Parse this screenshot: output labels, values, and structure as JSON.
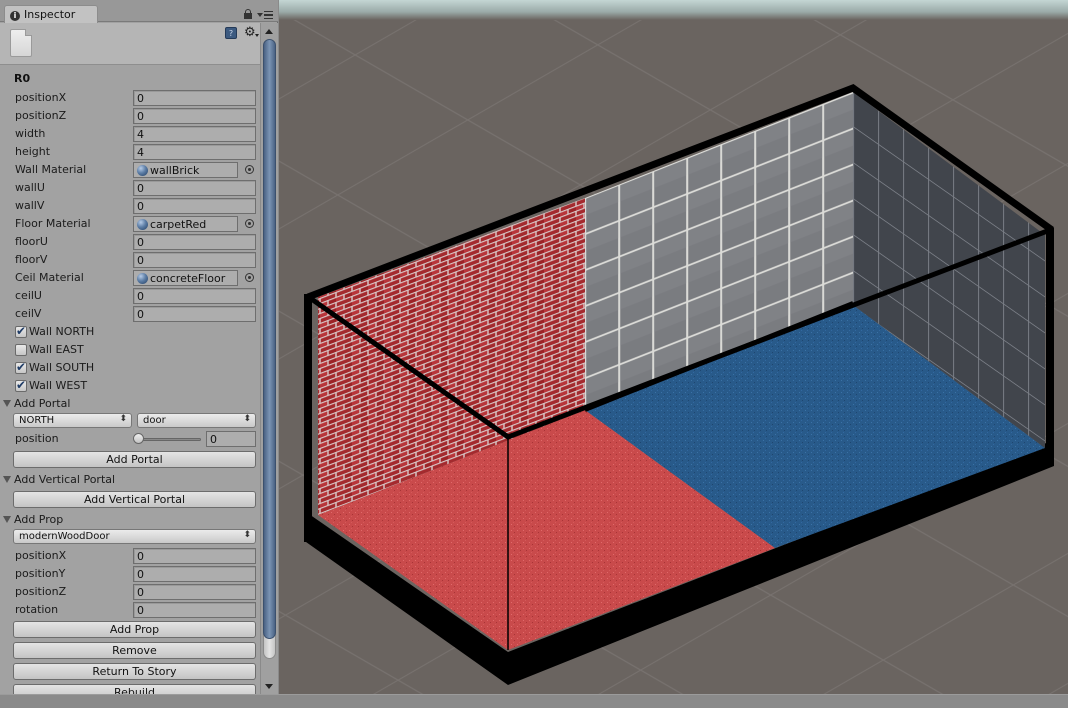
{
  "window": {
    "tab_title": "Inspector",
    "tab_icon": "i"
  },
  "header": {
    "help_glyph": "?",
    "gear_glyph": "⚙"
  },
  "object": {
    "name": "R0"
  },
  "fields": [
    {
      "label": "positionX",
      "value": "0"
    },
    {
      "label": "positionZ",
      "value": "0"
    },
    {
      "label": "width",
      "value": "4"
    },
    {
      "label": "height",
      "value": "4"
    },
    {
      "label": "Wall Material",
      "value": "wallBrick",
      "type": "material"
    },
    {
      "label": "wallU",
      "value": "0"
    },
    {
      "label": "wallV",
      "value": "0"
    },
    {
      "label": "Floor Material",
      "value": "carpetRed",
      "type": "material"
    },
    {
      "label": "floorU",
      "value": "0"
    },
    {
      "label": "floorV",
      "value": "0"
    },
    {
      "label": "Ceil Material",
      "value": "concreteFloor",
      "type": "material"
    },
    {
      "label": "ceilU",
      "value": "0"
    },
    {
      "label": "ceilV",
      "value": "0"
    }
  ],
  "walls": [
    {
      "label": "Wall NORTH",
      "checked": true
    },
    {
      "label": "Wall EAST",
      "checked": false
    },
    {
      "label": "Wall SOUTH",
      "checked": true
    },
    {
      "label": "Wall WEST",
      "checked": true
    }
  ],
  "add_portal": {
    "header": "Add Portal",
    "direction": "NORTH",
    "portal_type": "door",
    "position_label": "position",
    "position_value": "0",
    "position_fraction": 0,
    "button": "Add Portal",
    "updown_glyph": "⬍"
  },
  "add_vertical_portal": {
    "header": "Add Vertical Portal",
    "button": "Add Vertical Portal"
  },
  "add_prop": {
    "header": "Add Prop",
    "prop": "modernWoodDoor",
    "fields": [
      {
        "label": "positionX",
        "value": "0"
      },
      {
        "label": "positionY",
        "value": "0"
      },
      {
        "label": "positionZ",
        "value": "0"
      },
      {
        "label": "rotation",
        "value": "0"
      }
    ],
    "button": "Add Prop"
  },
  "actions": {
    "remove": "Remove",
    "return_to_story": "Return To Story",
    "rebuild": "Rebuild"
  },
  "scene": {
    "background_color": "#6a6460",
    "sky_color": "#b8cac8",
    "wall_brick_color": "#a8262a",
    "wall_tile_color": "#7a7c80",
    "wall_tile_dark_color": "#3c3f45",
    "floor_red_color": "#c84a4a",
    "floor_blue_color": "#2b5d8e",
    "outline_color": "#000000"
  }
}
